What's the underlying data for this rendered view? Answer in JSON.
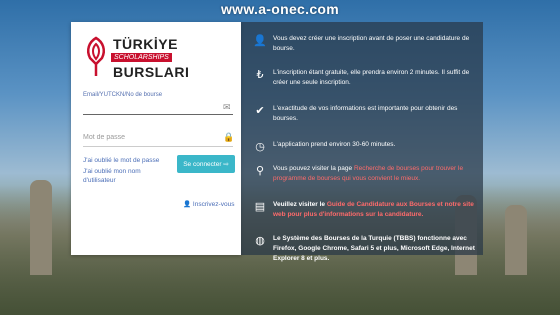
{
  "watermark": "www.a-onec.com",
  "logo": {
    "line1": "TÜRKİYE",
    "band": "SCHOLARSHIPS",
    "line2": "BURSLARI"
  },
  "login": {
    "email_label": "Email/YUTCKN/No de bourse",
    "email_value": "",
    "password_placeholder": "Mot de passe",
    "forgot_password": "J'ai oublié le mot de passe",
    "forgot_username": "J'ai oublié mon nom d'utilisateur",
    "connect_button": "Se connecter",
    "register_link": "Inscrivez-vous"
  },
  "info": [
    {
      "icon": "user-add-icon",
      "glyph": "👤",
      "text": "Vous devez créer une inscription avant de poser une candidature de bourse."
    },
    {
      "icon": "lira-icon",
      "glyph": "₺",
      "text": "L'inscription étant gratuite, elle prendra environ 2 minutes. Il suffit de créer une seule inscription."
    },
    {
      "icon": "shield-check-icon",
      "glyph": "✔",
      "text": "L'exactitude de vos informations est importante pour obtenir des bourses."
    },
    {
      "icon": "clock-icon",
      "glyph": "◷",
      "text": "L'application prend environ 30-60 minutes."
    },
    {
      "icon": "search-icon",
      "glyph": "⚲",
      "text_a": "Vous pouvez visiter la page ",
      "text_b": "Recherche de bourses pour trouver le programme de bourses qui vous convient le mieux."
    },
    {
      "icon": "document-icon",
      "glyph": "▤",
      "text_a": "Veuillez visiter le ",
      "text_b": "Guide de Candidature aux Bourses et notre site web pour plus d'informations sur la candidature."
    },
    {
      "icon": "globe-icon",
      "glyph": "◍",
      "text": "Le Système des Bourses de la Turquie (TBBS) fonctionne avec Firefox, Google Chrome, Safari 5 et plus, Microsoft Edge, Internet Explorer 8 et plus."
    }
  ]
}
